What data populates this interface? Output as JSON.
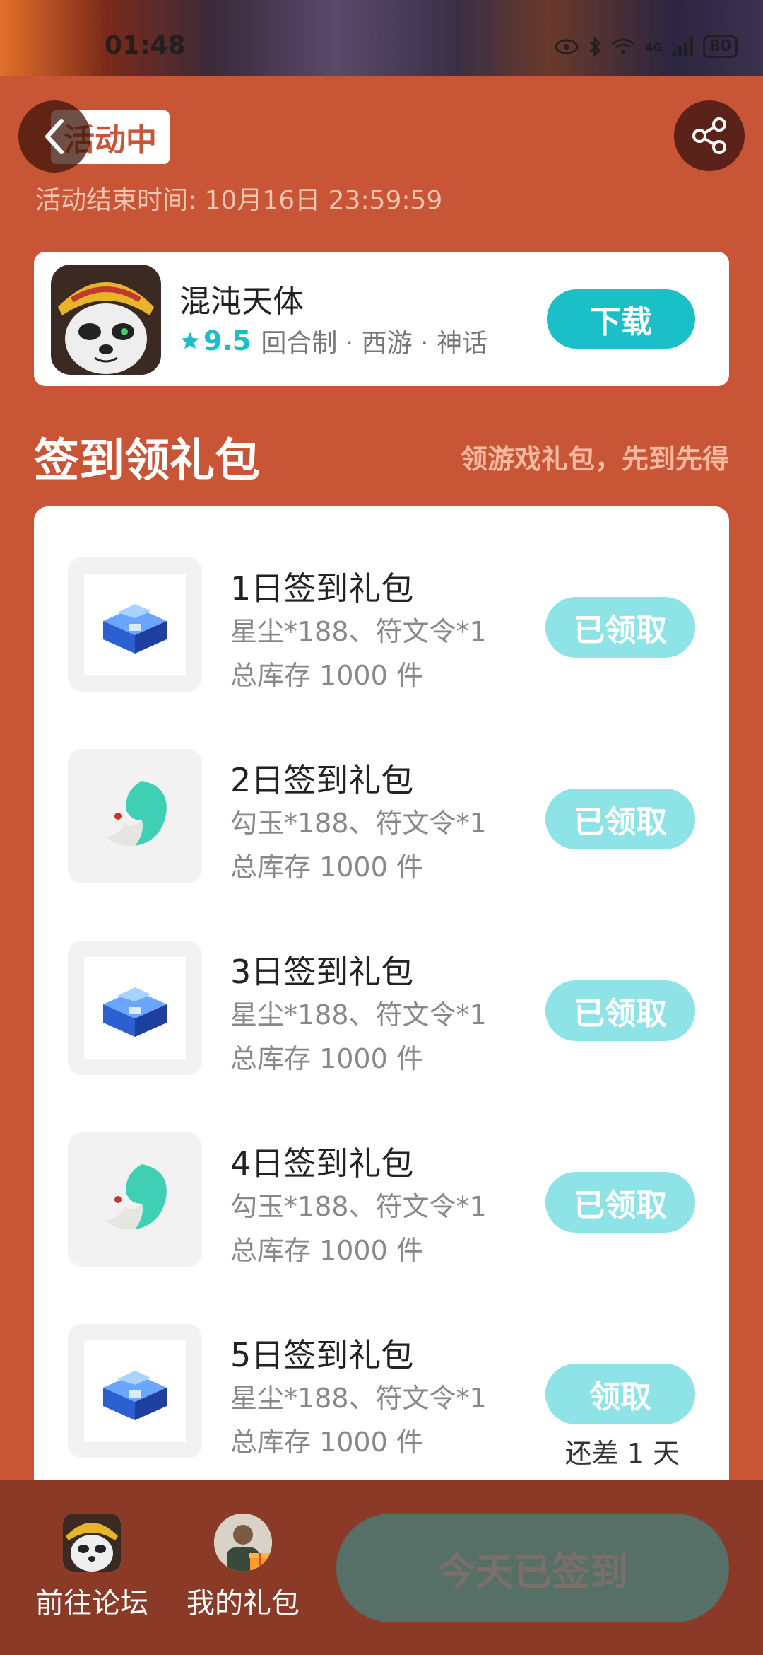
{
  "status_bar": {
    "time": "01:48",
    "battery": "80",
    "network": "4G"
  },
  "activity": {
    "status_label": "活动中",
    "end_time": "活动结束时间: 10月16日 23:59:59"
  },
  "game": {
    "name": "混沌天体",
    "rating": "9.5",
    "tags": "回合制 · 西游 · 神话",
    "download_label": "下载"
  },
  "section": {
    "title": "签到领礼包",
    "subtitle": "领游戏礼包，先到先得"
  },
  "gifts": [
    {
      "title": "1日签到礼包",
      "desc": "星尘*188、符文令*1",
      "stock": "总库存 1000 件",
      "button": "已领取",
      "icon": "blue-chest-icon"
    },
    {
      "title": "2日签到礼包",
      "desc": "勾玉*188、符文令*1",
      "stock": "总库存 1000 件",
      "button": "已领取",
      "icon": "jade-magatama-icon"
    },
    {
      "title": "3日签到礼包",
      "desc": "星尘*188、符文令*1",
      "stock": "总库存 1000 件",
      "button": "已领取",
      "icon": "blue-chest-icon"
    },
    {
      "title": "4日签到礼包",
      "desc": "勾玉*188、符文令*1",
      "stock": "总库存 1000 件",
      "button": "已领取",
      "icon": "jade-magatama-icon"
    },
    {
      "title": "5日签到礼包",
      "desc": "星尘*188、符文令*1",
      "stock": "总库存 1000 件",
      "button": "领取",
      "remaining": "还差 1 天",
      "icon": "blue-chest-icon"
    }
  ],
  "bottom": {
    "forum_label": "前往论坛",
    "my_gifts_label": "我的礼包",
    "signed_label": "今天已签到"
  },
  "colors": {
    "background": "#c85535",
    "accent": "#1bbfc8",
    "claimed_button": "#8de3e6",
    "bottom_bar": "#8b3a27",
    "signed_button": "#567067"
  }
}
